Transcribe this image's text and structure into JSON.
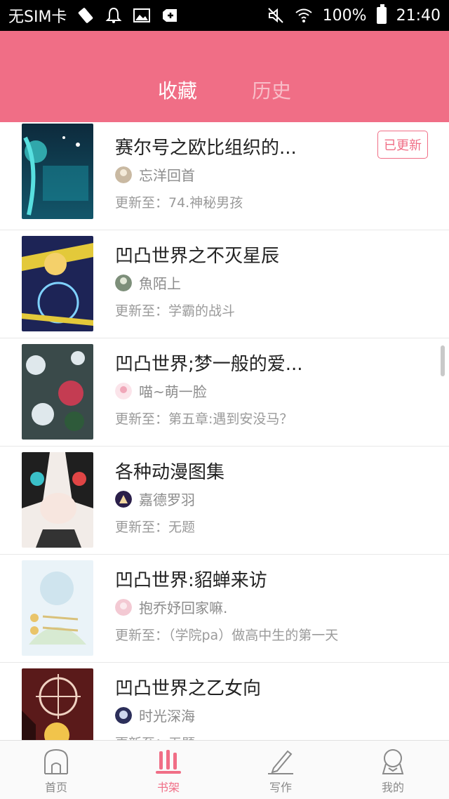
{
  "status_bar": {
    "carrier": "无SIM卡",
    "battery_percent": "100%",
    "time": "21:40",
    "left_icons": [
      "vibrate-icon",
      "bell-icon",
      "image-icon",
      "add-icon"
    ],
    "right_icons": [
      "mute-icon",
      "wifi-icon",
      "battery-icon"
    ]
  },
  "header": {
    "tabs": [
      {
        "label": "收藏",
        "active": true
      },
      {
        "label": "历史",
        "active": false
      }
    ],
    "accent_color": "#f06e86"
  },
  "books": [
    {
      "title": "赛尔号之欧比组织的...",
      "author": "忘洋回首",
      "update": "更新至：74.神秘男孩",
      "badge": "已更新"
    },
    {
      "title": "凹凸世界之不灭星辰",
      "author": "魚陌上",
      "update": "更新至：学霸的战斗"
    },
    {
      "title": "凹凸世界;梦一般的爱...",
      "author": "喵~萌一脸",
      "update": "更新至：第五章:遇到安没马？"
    },
    {
      "title": "各种动漫图集",
      "author": "嘉德罗羽",
      "update": "更新至：无题"
    },
    {
      "title": "凹凸世界:貂蝉来访",
      "author": "抱乔妤回家嘛.",
      "update": "更新至：（学院pa）做高中生的第一天"
    },
    {
      "title": "凹凸世界之乙女向",
      "author": "时光深海",
      "update": "更新至：无题"
    }
  ],
  "bottom_nav": [
    {
      "label": "首页",
      "icon": "home-icon",
      "active": false
    },
    {
      "label": "书架",
      "icon": "bookshelf-icon",
      "active": true
    },
    {
      "label": "写作",
      "icon": "pen-icon",
      "active": false
    },
    {
      "label": "我的",
      "icon": "profile-icon",
      "active": false
    }
  ]
}
